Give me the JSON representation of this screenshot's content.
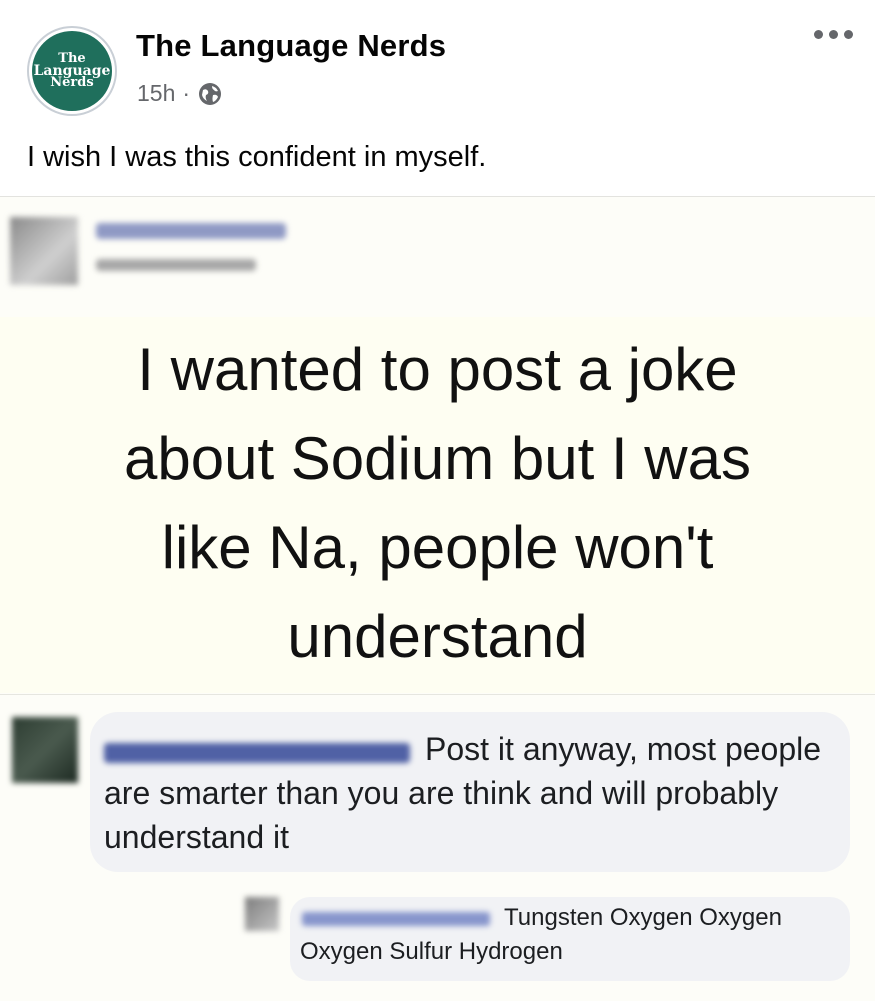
{
  "post": {
    "page_name": "The Language Nerds",
    "logo_text": [
      "The",
      "Language",
      "Nerds"
    ],
    "time": "15h",
    "separator": "·",
    "privacy_icon": "globe-icon",
    "more_icon": "more-horizontal-icon",
    "caption": "I wish I was this confident in myself."
  },
  "shared_image": {
    "status_lines": [
      "I wanted to post a joke",
      "about Sodium but I was",
      "like Na, people won't",
      "understand"
    ],
    "comment_1": {
      "text": "Post it anyway, most people are smarter than you are think and will probably understand it"
    },
    "comment_2": {
      "text": "Tungsten Oxygen Oxygen Oxygen Sulfur Hydrogen"
    }
  },
  "colors": {
    "logo_green": "#1f6f5c",
    "meta_gray": "#65676b",
    "bubble_bg": "#f1f2f5"
  }
}
